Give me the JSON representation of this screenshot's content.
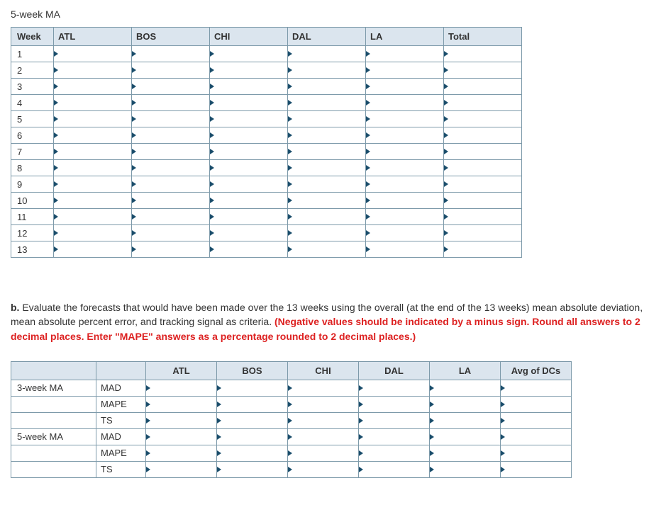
{
  "title": "5-week MA",
  "table1": {
    "headers": [
      "Week",
      "ATL",
      "BOS",
      "CHI",
      "DAL",
      "LA",
      "Total"
    ],
    "rows": [
      "1",
      "2",
      "3",
      "4",
      "5",
      "6",
      "7",
      "8",
      "9",
      "10",
      "11",
      "12",
      "13"
    ]
  },
  "question": {
    "prefix": "b.",
    "text": " Evaluate the forecasts that would have been made over the 13 weeks using the overall (at the end of the 13 weeks) mean absolute deviation, mean absolute percent error, and tracking signal as criteria. ",
    "red": "(Negative values should be indicated by a minus sign. Round all answers to 2 decimal places. Enter \"MAPE\" answers as a percentage rounded to 2 decimal places.)"
  },
  "table2": {
    "headers": [
      "",
      "",
      "ATL",
      "BOS",
      "CHI",
      "DAL",
      "LA",
      "Avg of DCs"
    ],
    "groups": [
      {
        "label": "3-week MA",
        "metrics": [
          "MAD",
          "MAPE",
          "TS"
        ]
      },
      {
        "label": "5-week MA",
        "metrics": [
          "MAD",
          "MAPE",
          "TS"
        ]
      }
    ]
  }
}
